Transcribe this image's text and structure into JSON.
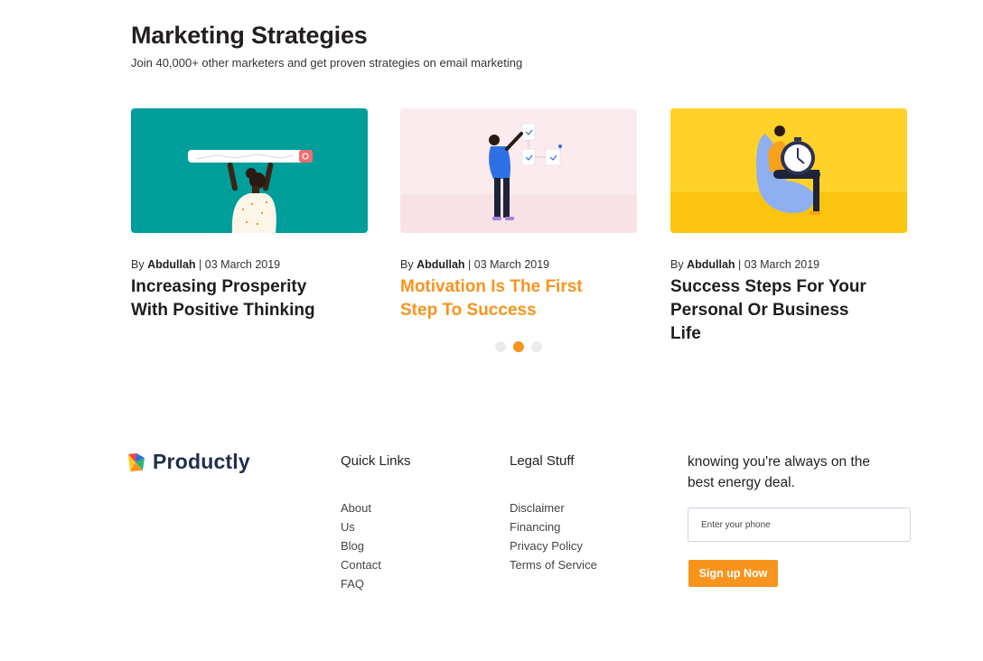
{
  "section": {
    "title": "Marketing Strategies",
    "subtitle": "Join 40,000+ other marketers and get proven strategies on email marketing"
  },
  "posts": [
    {
      "by": "By",
      "author": "Abdullah",
      "date": "| 03 March 2019",
      "title": "Increasing Prosperity With Positive Thinking",
      "bg": "#009e9a",
      "active": false
    },
    {
      "by": "By",
      "author": "Abdullah",
      "date": "| 03 March 2019",
      "title": "Motivation Is The First Step To Success",
      "bg": "#fbebee",
      "active": true
    },
    {
      "by": "By",
      "author": "Abdullah",
      "date": "| 03 March 2019",
      "title": "Success Steps For Your Personal Or Business Life",
      "bg": "#ffd12a",
      "active": false
    }
  ],
  "carousel": {
    "active_index": 1,
    "count": 3
  },
  "footer": {
    "brand": "Productly",
    "quick_links": {
      "heading": "Quick Links",
      "items": [
        "About",
        "Us",
        "Blog",
        "Contact",
        "FAQ"
      ]
    },
    "legal": {
      "heading": "Legal Stuff",
      "items": [
        "Disclaimer",
        "Financing",
        "Privacy Policy",
        "Terms of Service"
      ]
    },
    "newsletter": {
      "text": "knowing you're always on the best energy deal.",
      "phone_placeholder": "Enter your phone",
      "button_label": "Sign up Now"
    }
  },
  "colors": {
    "accent": "#f7941d",
    "brand_navy": "#1f2f4d"
  }
}
